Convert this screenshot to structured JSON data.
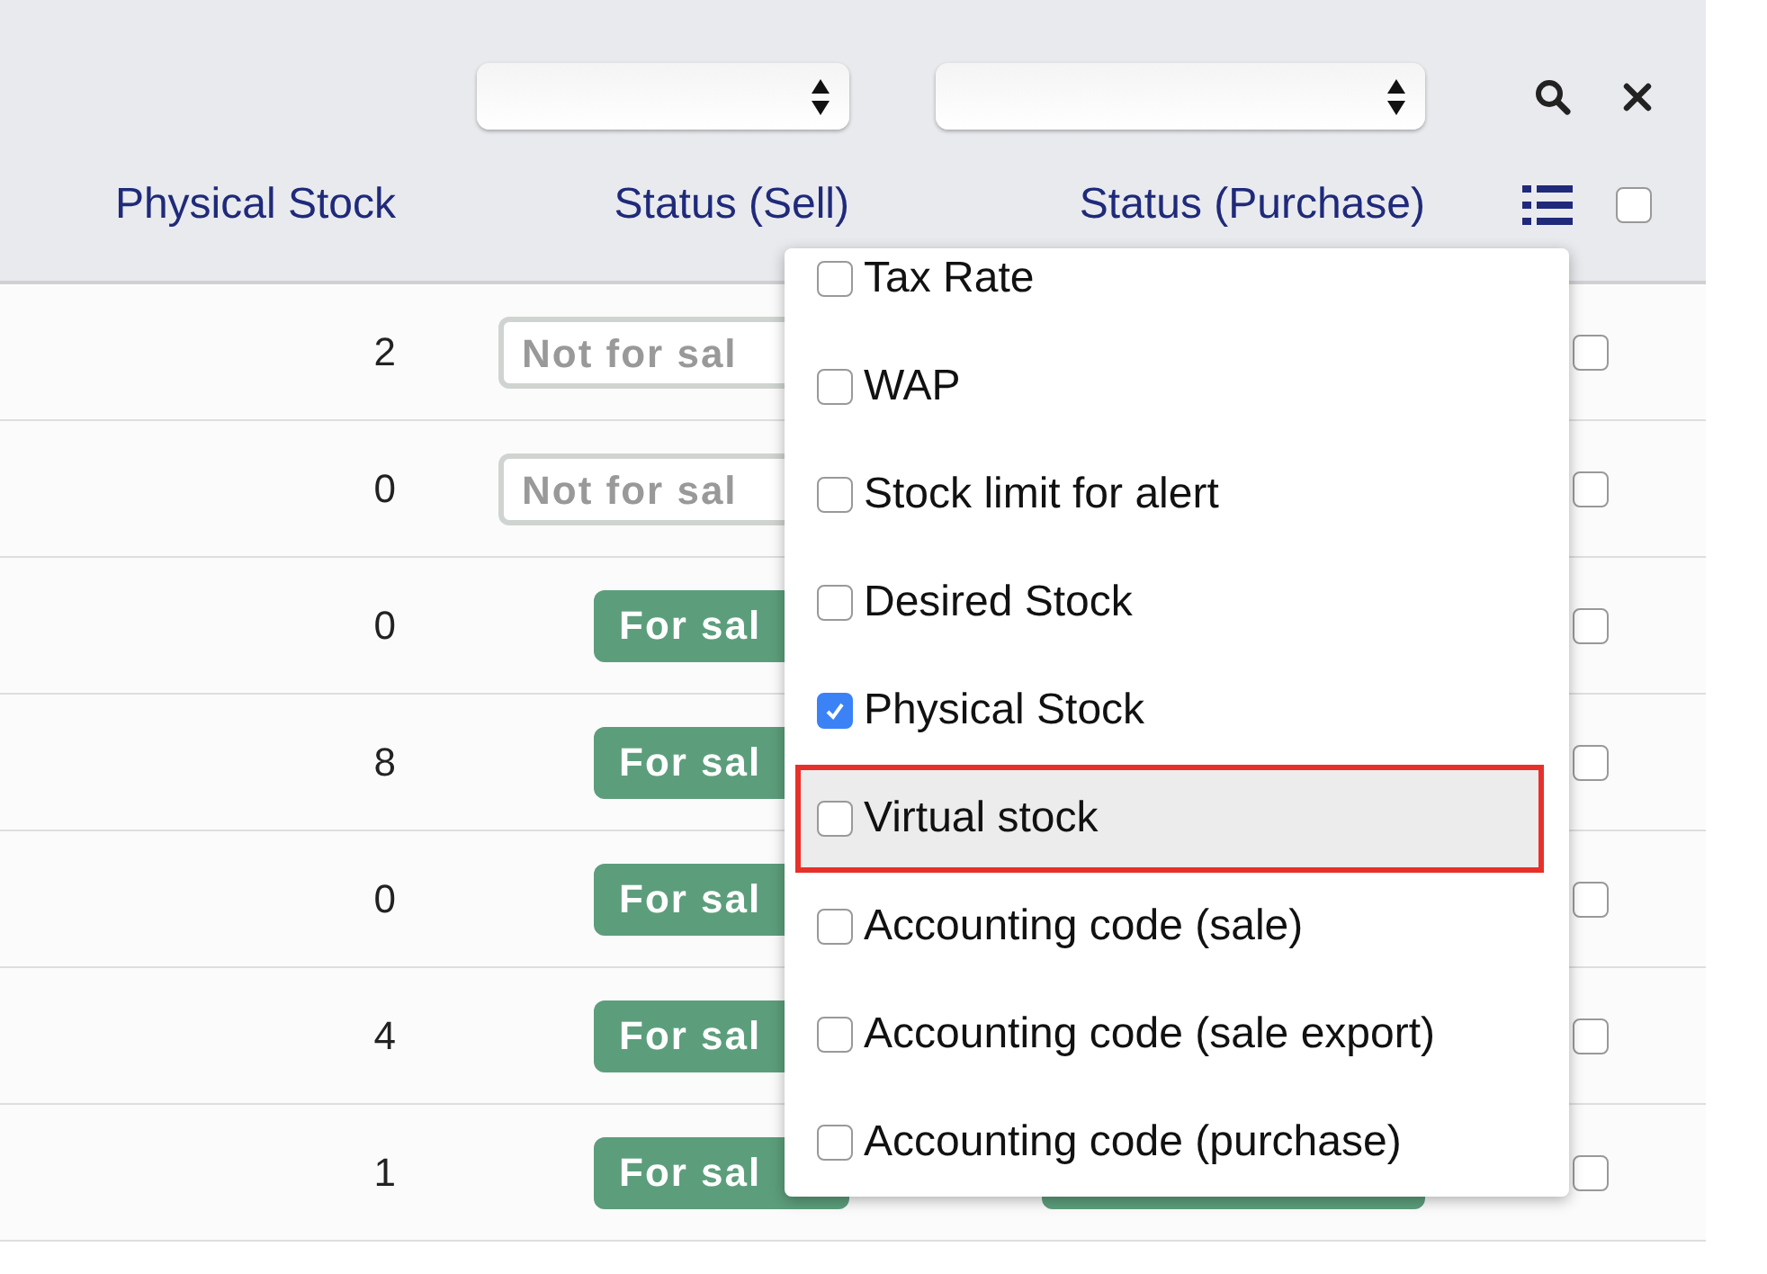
{
  "filters": [
    {
      "kind": "select"
    },
    {
      "kind": "select"
    }
  ],
  "columns": [
    "Physical Stock",
    "Status (Sell)",
    "Status (Purchase)"
  ],
  "header_checkbox": {
    "checked": false
  },
  "rows": [
    {
      "stock": "2",
      "sell": {
        "label": "Not for sal",
        "on": false
      },
      "checked": false
    },
    {
      "stock": "0",
      "sell": {
        "label": "Not for sal",
        "on": false
      },
      "checked": false
    },
    {
      "stock": "0",
      "sell": {
        "label": "For sal",
        "on": true
      },
      "checked": false
    },
    {
      "stock": "8",
      "sell": {
        "label": "For sal",
        "on": true
      },
      "checked": false
    },
    {
      "stock": "0",
      "sell": {
        "label": "For sal",
        "on": true
      },
      "checked": false
    },
    {
      "stock": "4",
      "sell": {
        "label": "For sal",
        "on": true
      },
      "checked": false
    },
    {
      "stock": "1",
      "sell": {
        "label": "For sal",
        "on": true
      },
      "checked": false
    }
  ],
  "column_menu": [
    {
      "label": "Tax Rate",
      "checked": false,
      "highlighted": false
    },
    {
      "label": "WAP",
      "checked": false,
      "highlighted": false
    },
    {
      "label": "Stock limit for alert",
      "checked": false,
      "highlighted": false
    },
    {
      "label": "Desired Stock",
      "checked": false,
      "highlighted": false
    },
    {
      "label": "Physical Stock",
      "checked": true,
      "highlighted": false
    },
    {
      "label": "Virtual stock",
      "checked": false,
      "highlighted": true
    },
    {
      "label": "Accounting code (sale)",
      "checked": false,
      "highlighted": false
    },
    {
      "label": "Accounting code (sale export)",
      "checked": false,
      "highlighted": false
    },
    {
      "label": "Accounting code (purchase)",
      "checked": false,
      "highlighted": false
    }
  ]
}
